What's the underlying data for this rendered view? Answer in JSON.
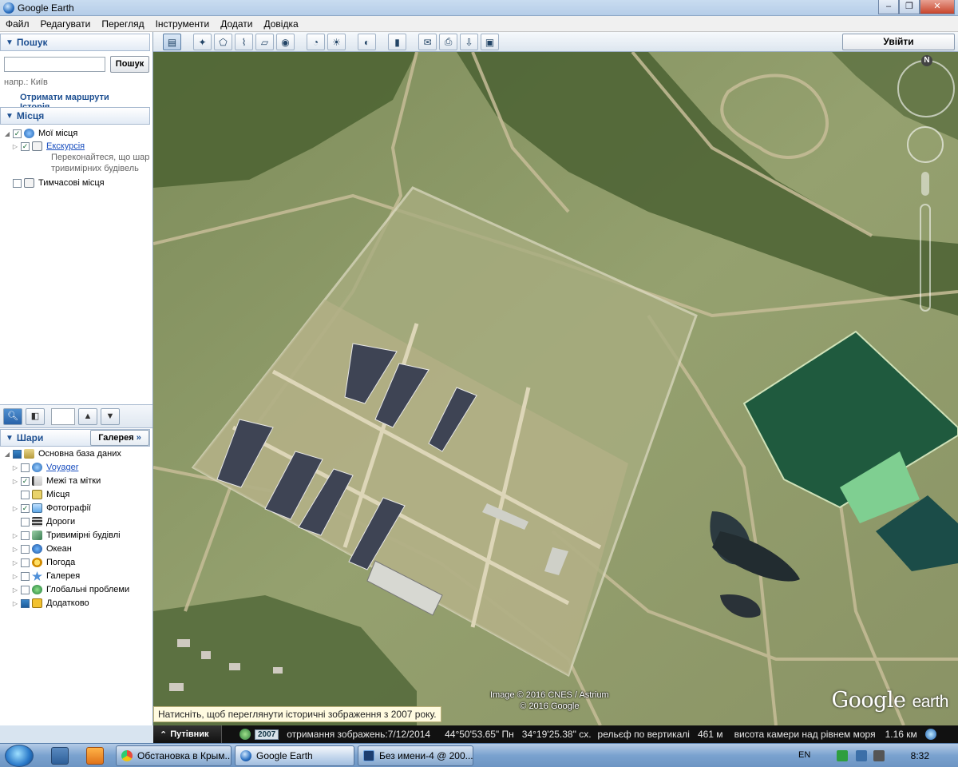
{
  "window": {
    "title": "Google Earth"
  },
  "menu": [
    "Файл",
    "Редагувати",
    "Перегляд",
    "Інструменти",
    "Додати",
    "Довідка"
  ],
  "toolbar": {
    "login_label": "Увійти"
  },
  "search": {
    "header": "Пошук",
    "button": "Пошук",
    "example": "напр.: Київ",
    "link_routes": "Отримати маршрути",
    "link_history": "Історія"
  },
  "places": {
    "header": "Місця",
    "items": [
      {
        "label": "Мої місця"
      },
      {
        "label": "Екскурсія"
      },
      {
        "label": "Переконайтеся, що шар"
      },
      {
        "label": "тривимірних будівель"
      },
      {
        "label": "Тимчасові місця"
      }
    ]
  },
  "layers": {
    "header": "Шари",
    "gallery_label": "Галерея",
    "gallery_arrow": "»",
    "items": [
      {
        "label": "Основна база даних"
      },
      {
        "label": "Voyager"
      },
      {
        "label": "Межі та мітки"
      },
      {
        "label": "Місця"
      },
      {
        "label": "Фотографії"
      },
      {
        "label": "Дороги"
      },
      {
        "label": "Тривимірні будівлі"
      },
      {
        "label": "Океан"
      },
      {
        "label": "Погода"
      },
      {
        "label": "Галерея"
      },
      {
        "label": "Глобальні проблеми"
      },
      {
        "label": "Додатково"
      }
    ]
  },
  "map": {
    "history_tip": "Натисніть, щоб переглянути історичні зображення з 2007 року.",
    "credits_line1": "Image © 2016 CNES / Astrium",
    "credits_line2": "© 2016 Google",
    "logo_google": "Google",
    "logo_earth": "earth",
    "compass_label": "N"
  },
  "status": {
    "guide_label": "Путівник",
    "year_badge": "2007",
    "date_text": "отримання зображень:7/12/2014",
    "lat": "44°50'53.65\" Пн",
    "lon": "34°19'25.38\" сх.",
    "elev_label": "рельєф по вертикалі",
    "elev_value": "461 м",
    "cam_label": "висота камери над рівнем моря",
    "cam_value": "1.16 км"
  },
  "taskbar": {
    "tasks": [
      "Обстановка в Крым...",
      "Google Earth",
      "Без имени-4 @ 200..."
    ],
    "lang": "EN",
    "clock": "8:32"
  }
}
